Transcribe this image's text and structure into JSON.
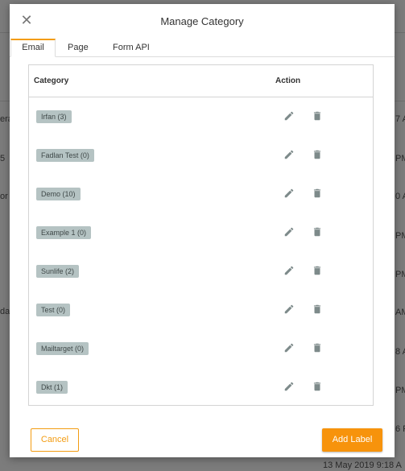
{
  "background": {
    "left_fragments": [
      "era",
      "5",
      "or",
      "",
      "",
      "da"
    ],
    "right_fragments": [
      "7 A",
      "PM",
      "0 A",
      "PM",
      "PM",
      "AM",
      "8 A",
      "PM",
      "6 P"
    ],
    "bottom_text": "13 May 2019   9:18 A"
  },
  "modal": {
    "title": "Manage Category",
    "close_glyph": "✕",
    "tabs": [
      {
        "label": "Email",
        "active": true
      },
      {
        "label": "Page",
        "active": false
      },
      {
        "label": "Form API",
        "active": false
      }
    ],
    "table": {
      "headers": {
        "category": "Category",
        "action": "Action"
      },
      "rows": [
        {
          "label": "Irfan (3)"
        },
        {
          "label": "Fadlan Test (0)"
        },
        {
          "label": "Demo (10)"
        },
        {
          "label": "Example 1 (0)"
        },
        {
          "label": "Sunlife (2)"
        },
        {
          "label": "Test (0)"
        },
        {
          "label": "Mailtarget (0)"
        },
        {
          "label": "Dkt (1)"
        }
      ]
    },
    "cancel_label": "Cancel",
    "add_label": "Add Label"
  },
  "colors": {
    "accent": "#f7930c",
    "badge_bg": "#b5c3c3",
    "icon": "#7d8a8a"
  },
  "icons": {
    "edit": "pencil-icon",
    "delete": "trash-icon",
    "close": "close-icon"
  }
}
